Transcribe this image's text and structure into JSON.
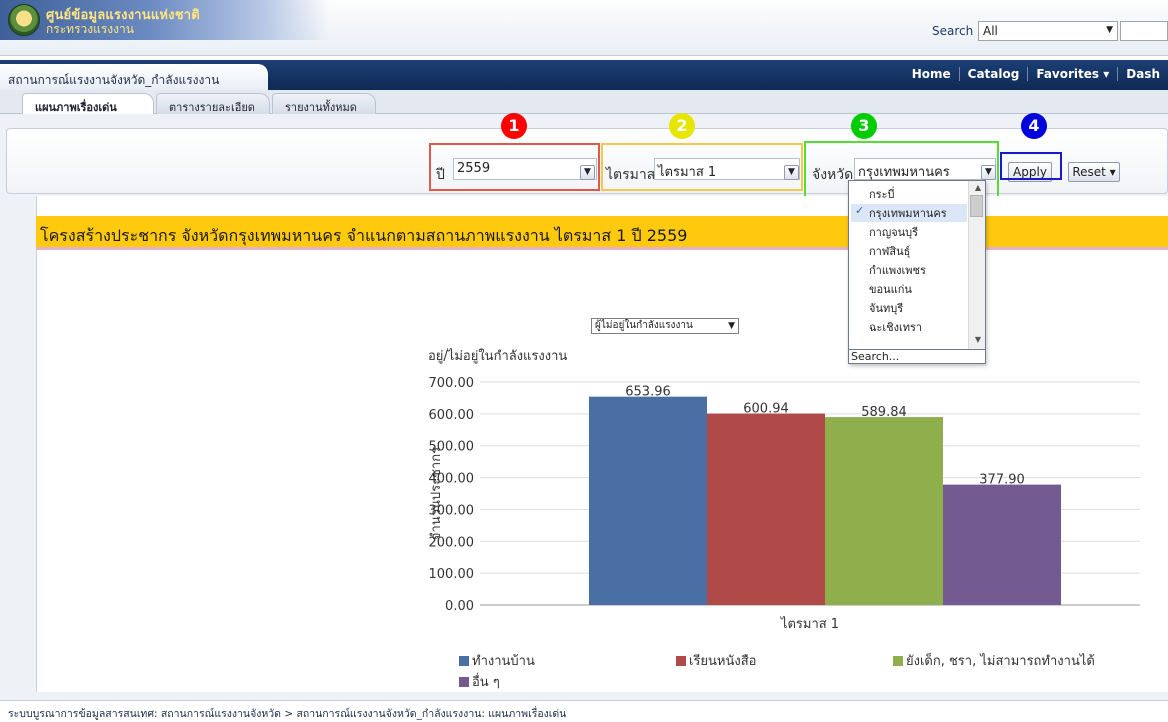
{
  "header": {
    "logo_line1": "ศูนย์ข้อมูลแรงงานแห่งชาติ",
    "logo_line2": "กระทรวงแรงงาน",
    "search_label": "Search",
    "search_scope": "All"
  },
  "nav": {
    "page_title": "สถานการณ์แรงงานจังหวัด_กำลังแรงงาน",
    "links": [
      "Home",
      "Catalog",
      "Favorites ▾",
      "Dash"
    ]
  },
  "tabs": [
    "แผนภาพเรื่องเด่น",
    "ตารางรายละเอียด",
    "รายงานทั้งหมด"
  ],
  "prompts": {
    "year_label": "ปี",
    "year_value": "2559",
    "quarter_label": "ไตรมาส",
    "quarter_value": "ไตรมาส 1",
    "province_label": "จังหวัด",
    "province_value": "กรุงเทพมหานคร",
    "apply_label": "Apply",
    "reset_label": "Reset ▾",
    "province_options": [
      "กระบี่",
      "กรุงเทพมหานคร",
      "กาญจนบุรี",
      "กาฬสินธุ์",
      "กำแพงเพชร",
      "ขอนแก่น",
      "จันทบุรี",
      "ฉะเชิงเทรา"
    ],
    "province_selected_index": 1,
    "dropdown_search": "Search..."
  },
  "annotations": [
    {
      "number": "1",
      "color": "#ff0000"
    },
    {
      "number": "2",
      "color": "#e6e600"
    },
    {
      "number": "3",
      "color": "#00cc00"
    },
    {
      "number": "4",
      "color": "#0000dd"
    }
  ],
  "report": {
    "title": "โครงสร้างประชากร จังหวัดกรุงเทพมหานคร จำแนกตามสถานภาพแรงงาน ไตรมาส 1 ปี 2559",
    "view_label": "อยู่/ไม่อยู่ในกำลังแรงงาน",
    "view_selected": "ผู้ไม่อยู่ในกำลังแรงงาน"
  },
  "chart_data": {
    "type": "bar",
    "categories": [
      "ไตรมาส 1"
    ],
    "series": [
      {
        "name": "ทำงานบ้าน",
        "values": [
          653.96
        ],
        "color": "#4a6fa5"
      },
      {
        "name": "เรียนหนังสือ",
        "values": [
          600.94
        ],
        "color": "#b04a49"
      },
      {
        "name": "ยังเด็ก, ชรา, ไม่สามารถทำงานได้",
        "values": [
          589.84
        ],
        "color": "#8fae4c"
      },
      {
        "name": "อื่น ๆ",
        "values": [
          377.9
        ],
        "color": "#735b92"
      }
    ],
    "value_labels": [
      "653.96",
      "600.94",
      "589.84",
      "377.90"
    ],
    "ylabel": "จำนวนประชากร",
    "xlabel": "ไตรมาส 1",
    "ylim": [
      0,
      700
    ],
    "yticks": [
      "0.00",
      "100.00",
      "200.00",
      "300.00",
      "400.00",
      "500.00",
      "600.00",
      "700.00"
    ],
    "grid": true,
    "legend_position": "bottom"
  },
  "footer": {
    "breadcrumb": "ระบบบูรณาการข้อมูลสารสนเทศ: สถานการณ์แรงงานจังหวัด  >  สถานการณ์แรงงานจังหวัด_กำลังแรงงาน: แผนภาพเรื่องเด่น"
  }
}
